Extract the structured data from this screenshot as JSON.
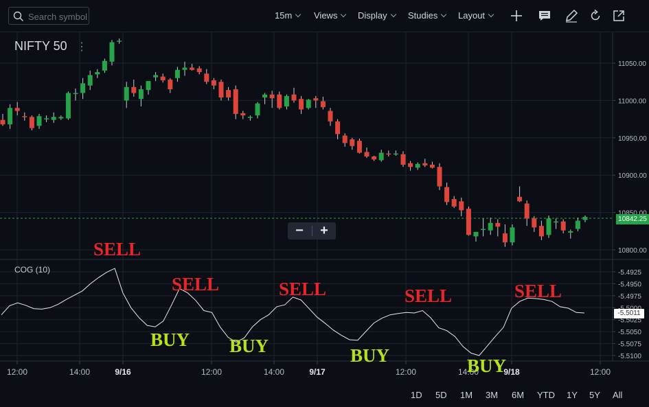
{
  "toolbar": {
    "search_placeholder": "Search symbol",
    "interval": "15m",
    "views": "Views",
    "display": "Display",
    "studies": "Studies",
    "layout": "Layout",
    "icons": [
      "plus-icon",
      "comment-icon",
      "pencil-icon",
      "refresh-icon",
      "external-link-icon"
    ]
  },
  "symbol": {
    "name": "NIFTY 50",
    "menu": "⋮"
  },
  "study": {
    "label": "COG (10)"
  },
  "zoom": {
    "minus": "−",
    "plus": "+"
  },
  "annotations": {
    "sell": [
      "SELL",
      "SELL",
      "SELL",
      "SELL",
      "SELL"
    ],
    "buy": [
      "BUY",
      "BUY",
      "BUY",
      "BUY"
    ]
  },
  "ranges": [
    "1D",
    "5D",
    "1M",
    "3M",
    "6M",
    "YTD",
    "1Y",
    "5Y",
    "All"
  ],
  "colors": {
    "up": "#26a44a",
    "down": "#e0453c",
    "background": "#0b0e14",
    "grid": "#1c2430",
    "sell": "#e8262a",
    "buy": "#b6e21a"
  },
  "chart_data": [
    {
      "type": "candlestick",
      "title": "NIFTY 50",
      "interval": "15m",
      "x_ticks": [
        "12:00",
        "14:00",
        "9/16",
        "12:00",
        "14:00",
        "9/17",
        "12:00",
        "14:00",
        "9/18",
        "12:00"
      ],
      "y_ticks": [
        "11050.00",
        "11000.00",
        "10950.00",
        "10900.00",
        "10850.00",
        "10800.00"
      ],
      "ylim": [
        10790,
        11080
      ],
      "last_price": "10842.25",
      "ohlc": [
        [
          10974,
          10982,
          10966,
          10968
        ],
        [
          10968,
          10995,
          10962,
          10990
        ],
        [
          10990,
          10998,
          10980,
          10986
        ],
        [
          10979,
          10984,
          10973,
          10978
        ],
        [
          10978,
          10980,
          10960,
          10963
        ],
        [
          10966,
          10982,
          10962,
          10979
        ],
        [
          10975,
          10980,
          10971,
          10976
        ],
        [
          10974,
          10984,
          10970,
          10978
        ],
        [
          10976,
          10980,
          10974,
          10978
        ],
        [
          10976,
          11012,
          10974,
          11010
        ],
        [
          11010,
          11016,
          11000,
          11010
        ],
        [
          11010,
          11030,
          11002,
          11023
        ],
        [
          11020,
          11040,
          11014,
          11034
        ],
        [
          11035,
          11042,
          11030,
          11038
        ],
        [
          11040,
          11056,
          11037,
          11053
        ],
        [
          11052,
          11081,
          11047,
          11078
        ],
        [
          11079,
          11083,
          11076,
          11080
        ],
        [
          11000,
          11025,
          10990,
          11018
        ],
        [
          11018,
          11028,
          11005,
          11010
        ],
        [
          11002,
          11020,
          10992,
          11015
        ],
        [
          11014,
          11026,
          11008,
          11026
        ],
        [
          11031,
          11038,
          11026,
          11034
        ],
        [
          11032,
          11036,
          11024,
          11027
        ],
        [
          11028,
          11030,
          11010,
          11015
        ],
        [
          11030,
          11045,
          11025,
          11041
        ],
        [
          11041,
          11052,
          11033,
          11044
        ],
        [
          11044,
          11049,
          11040,
          11041
        ],
        [
          11043,
          11046,
          11035,
          11038
        ],
        [
          11036,
          11042,
          11022,
          11025
        ],
        [
          11027,
          11030,
          11015,
          11020
        ],
        [
          11025,
          11028,
          11000,
          11004
        ],
        [
          11014,
          11018,
          11000,
          11004
        ],
        [
          11015,
          11020,
          10975,
          10982
        ],
        [
          10983,
          10986,
          10975,
          10980
        ],
        [
          10977,
          10980,
          10973,
          10978
        ],
        [
          10980,
          10998,
          10976,
          10996
        ],
        [
          11004,
          11010,
          10995,
          11008
        ],
        [
          11008,
          11013,
          10990,
          11003
        ],
        [
          11008,
          11012,
          10988,
          10990
        ],
        [
          10992,
          11008,
          10988,
          11006
        ],
        [
          11008,
          11017,
          10997,
          11000
        ],
        [
          11002,
          11006,
          10982,
          10988
        ],
        [
          10990,
          11002,
          10988,
          11001
        ],
        [
          11003,
          11006,
          10990,
          11000
        ],
        [
          10999,
          11005,
          10988,
          10991
        ],
        [
          10986,
          10990,
          10966,
          10972
        ],
        [
          10972,
          10975,
          10948,
          10955
        ],
        [
          10953,
          10956,
          10938,
          10943
        ],
        [
          10948,
          10950,
          10934,
          10939
        ],
        [
          10946,
          10949,
          10929,
          10930
        ],
        [
          10931,
          10937,
          10923,
          10925
        ],
        [
          10925,
          10926,
          10919,
          10921
        ],
        [
          10920,
          10934,
          10918,
          10930
        ],
        [
          10929,
          10933,
          10925,
          10928
        ],
        [
          10929,
          10933,
          10926,
          10929
        ],
        [
          10928,
          10932,
          10911,
          10914
        ],
        [
          10916,
          10919,
          10906,
          10911
        ],
        [
          10910,
          10917,
          10907,
          10915
        ],
        [
          10916,
          10922,
          10911,
          10913
        ],
        [
          10914,
          10918,
          10909,
          10910
        ],
        [
          10911,
          10916,
          10880,
          10885
        ],
        [
          10884,
          10890,
          10860,
          10864
        ],
        [
          10868,
          10872,
          10856,
          10858
        ],
        [
          10865,
          10870,
          10845,
          10853
        ],
        [
          10855,
          10858,
          10819,
          10820
        ],
        [
          10818,
          10824,
          10811,
          10824
        ],
        [
          10828,
          10842,
          10818,
          10828
        ],
        [
          10826,
          10843,
          10820,
          10836
        ],
        [
          10836,
          10841,
          10818,
          10831
        ],
        [
          10822,
          10834,
          10804,
          10810
        ],
        [
          10810,
          10834,
          10806,
          10830
        ],
        [
          10871,
          10885,
          10864,
          10865
        ],
        [
          10862,
          10866,
          10832,
          10842
        ],
        [
          10842,
          10845,
          10824,
          10830
        ],
        [
          10832,
          10839,
          10813,
          10818
        ],
        [
          10820,
          10846,
          10816,
          10842
        ],
        [
          10838,
          10842,
          10828,
          10838
        ],
        [
          10838,
          10841,
          10822,
          10826
        ],
        [
          10823,
          10827,
          10815,
          10825
        ],
        [
          10828,
          10843,
          10825,
          10839
        ],
        [
          10840,
          10846,
          10837,
          10844
        ]
      ]
    },
    {
      "type": "line",
      "title": "COG (10)",
      "y_ticks": [
        "-5.4925",
        "-5.4950",
        "-5.4975",
        "-5.5000",
        "-5.5025",
        "-5.5050",
        "-5.5075",
        "-5.5100"
      ],
      "ylim": [
        -5.5113,
        -5.4913
      ],
      "last_value": "-5.5011",
      "series": [
        {
          "values": [
            -5.5015,
            -5.4996,
            -5.499,
            -5.4995,
            -5.5002,
            -5.5003,
            -5.5,
            -5.4993,
            -5.4983,
            -5.4974,
            -5.4965,
            -5.495,
            -5.4937,
            -5.4926,
            -5.4918,
            -5.4969,
            -5.5,
            -5.5021,
            -5.5037,
            -5.504,
            -5.5028,
            -5.4995,
            -5.496,
            -5.4969,
            -5.4985,
            -5.5006,
            -5.501,
            -5.504,
            -5.5062,
            -5.5072,
            -5.5063,
            -5.504,
            -5.5025,
            -5.5015,
            -5.4998,
            -5.4994,
            -5.4978,
            -5.4984,
            -5.5002,
            -5.502,
            -5.5033,
            -5.5047,
            -5.5058,
            -5.5067,
            -5.5068,
            -5.505,
            -5.5032,
            -5.5022,
            -5.5015,
            -5.5012,
            -5.501,
            -5.5011,
            -5.5006,
            -5.5021,
            -5.5042,
            -5.5048,
            -5.506,
            -5.5081,
            -5.5095,
            -5.51,
            -5.508,
            -5.506,
            -5.5041,
            -5.5001,
            -5.4987,
            -5.498,
            -5.4981,
            -5.4983,
            -5.4987,
            -5.4998,
            -5.5001,
            -5.501,
            -5.5011
          ]
        }
      ]
    }
  ]
}
